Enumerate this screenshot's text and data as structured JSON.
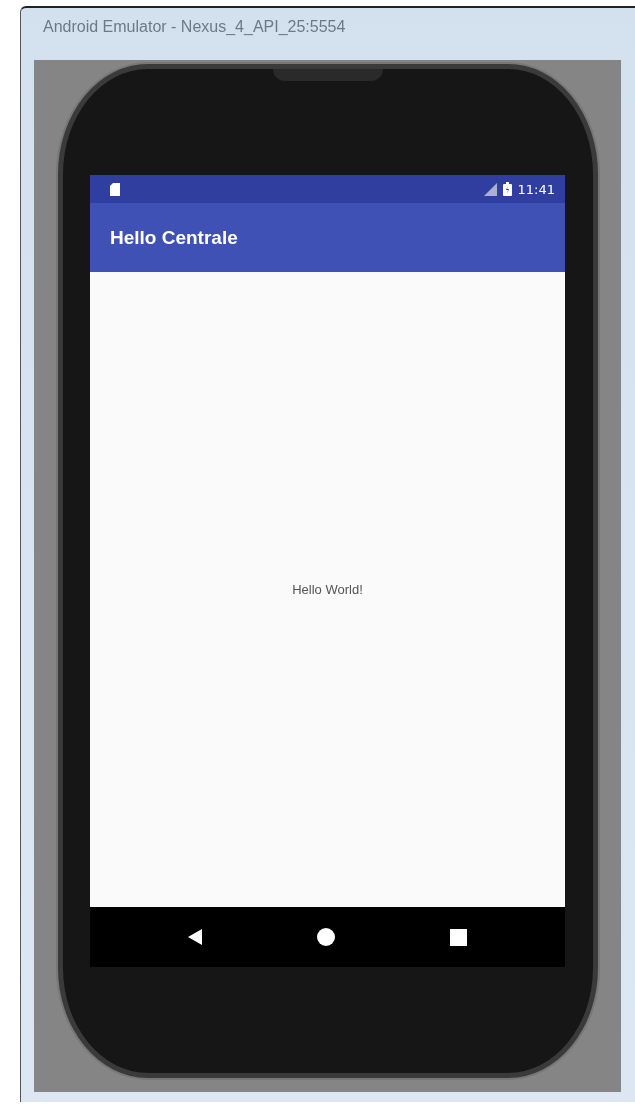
{
  "window": {
    "title": "Android Emulator - Nexus_4_API_25:5554"
  },
  "status_bar": {
    "time": "11:41"
  },
  "app_bar": {
    "title": "Hello Centrale"
  },
  "content": {
    "text": "Hello World!"
  }
}
